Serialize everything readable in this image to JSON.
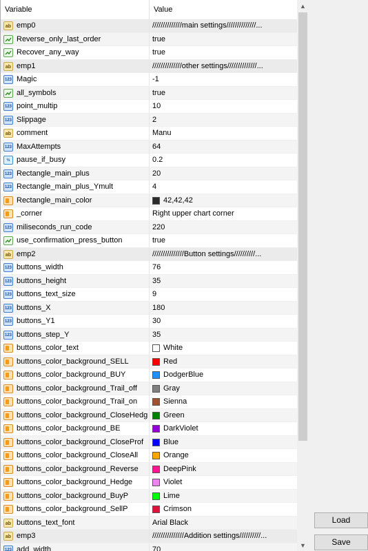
{
  "columns": {
    "variable": "Variable",
    "value": "Value"
  },
  "rows": [
    {
      "icon": "ab",
      "name": "emp0",
      "value": "//////////////main settings//////////////...",
      "sep": true
    },
    {
      "icon": "bool",
      "name": "Reverse_only_last_order",
      "value": "true"
    },
    {
      "icon": "bool",
      "name": "Recover_any_way",
      "value": "true"
    },
    {
      "icon": "ab",
      "name": "emp1",
      "value": "//////////////other settings//////////////...",
      "sep": true
    },
    {
      "icon": "num",
      "name": "Magic",
      "value": "-1"
    },
    {
      "icon": "bool",
      "name": "all_symbols",
      "value": "true"
    },
    {
      "icon": "num",
      "name": "point_multip",
      "value": "10"
    },
    {
      "icon": "num",
      "name": "Slippage",
      "value": "2"
    },
    {
      "icon": "ab",
      "name": "comment",
      "value": "Manu"
    },
    {
      "icon": "num",
      "name": "MaxAttempts",
      "value": "64"
    },
    {
      "icon": "float",
      "name": "pause_if_busy",
      "value": "0.2"
    },
    {
      "icon": "num",
      "name": "Rectangle_main_plus",
      "value": "20"
    },
    {
      "icon": "num",
      "name": "Rectangle_main_plus_Ymult",
      "value": "4"
    },
    {
      "icon": "color",
      "name": "Rectangle_main_color",
      "value": "42,42,42",
      "swatch": "#2a2a2a"
    },
    {
      "icon": "color",
      "name": "_corner",
      "value": "Right upper chart corner"
    },
    {
      "icon": "num",
      "name": "miliseconds_run_code",
      "value": "220"
    },
    {
      "icon": "bool",
      "name": "use_confirmation_press_button",
      "value": "true"
    },
    {
      "icon": "ab",
      "name": "emp2",
      "value": "///////////////Button settings//////////...",
      "sep": true
    },
    {
      "icon": "num",
      "name": "buttons_width",
      "value": "76"
    },
    {
      "icon": "num",
      "name": "buttons_height",
      "value": "35"
    },
    {
      "icon": "num",
      "name": "buttons_text_size",
      "value": "9"
    },
    {
      "icon": "num",
      "name": "buttons_X",
      "value": "180"
    },
    {
      "icon": "num",
      "name": "buttons_Y1",
      "value": "30"
    },
    {
      "icon": "num",
      "name": "buttons_step_Y",
      "value": "35"
    },
    {
      "icon": "color",
      "name": "buttons_color_text",
      "value": "White",
      "swatch": "#ffffff"
    },
    {
      "icon": "color",
      "name": "buttons_color_background_SELL",
      "value": "Red",
      "swatch": "#ff0000"
    },
    {
      "icon": "color",
      "name": "buttons_color_background_BUY",
      "value": "DodgerBlue",
      "swatch": "#1e90ff"
    },
    {
      "icon": "color",
      "name": "buttons_color_background_Trail_off",
      "value": "Gray",
      "swatch": "#808080"
    },
    {
      "icon": "color",
      "name": "buttons_color_background_Trail_on",
      "value": "Sienna",
      "swatch": "#a0522d"
    },
    {
      "icon": "color",
      "name": "buttons_color_background_CloseHedg",
      "value": "Green",
      "swatch": "#008000"
    },
    {
      "icon": "color",
      "name": "buttons_color_background_BE",
      "value": "DarkViolet",
      "swatch": "#9400d3"
    },
    {
      "icon": "color",
      "name": "buttons_color_background_CloseProf",
      "value": "Blue",
      "swatch": "#0000ff"
    },
    {
      "icon": "color",
      "name": "buttons_color_background_CloseAll",
      "value": "Orange",
      "swatch": "#ffa500"
    },
    {
      "icon": "color",
      "name": "buttons_color_background_Reverse",
      "value": "DeepPink",
      "swatch": "#ff1493"
    },
    {
      "icon": "color",
      "name": "buttons_color_background_Hedge",
      "value": "Violet",
      "swatch": "#ee82ee"
    },
    {
      "icon": "color",
      "name": "buttons_color_background_BuyP",
      "value": "Lime",
      "swatch": "#00ff00"
    },
    {
      "icon": "color",
      "name": "buttons_color_background_SellP",
      "value": "Crimson",
      "swatch": "#dc143c"
    },
    {
      "icon": "ab",
      "name": "buttons_text_font",
      "value": "Arial Black"
    },
    {
      "icon": "ab",
      "name": "emp3",
      "value": "///////////////Addition settings//////////...",
      "sep": true
    },
    {
      "icon": "num",
      "name": "add_width",
      "value": "70"
    }
  ],
  "buttons": {
    "load": "Load",
    "save": "Save"
  },
  "scrollbar": {
    "up_icon": "scroll-up-arrow",
    "down_icon": "scroll-down-arrow"
  }
}
